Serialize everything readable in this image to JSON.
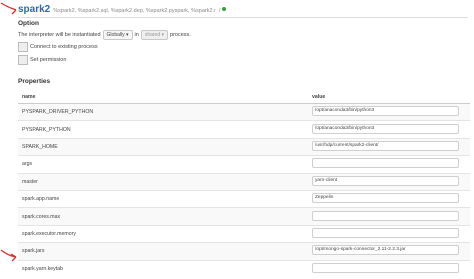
{
  "interpreter": {
    "title": "spark2",
    "bindings": "%spark2, %spark2.sql, %spark2.dep, %spark2.pyspark, %spark2.r",
    "status_color": "#3c9c40"
  },
  "option": {
    "heading": "Option",
    "instantiation_prefix": "The interpreter will be instantiated",
    "scope_value": "Globally",
    "in_label": "in",
    "mode_value": "shared",
    "instantiation_suffix": "process.",
    "connect_existing": "Connect to existing process",
    "set_permission": "Set permission"
  },
  "properties": {
    "heading": "Properties",
    "columns": {
      "name": "name",
      "value": "value"
    },
    "rows": [
      {
        "name": "PYSPARK_DRIVER_PYTHON",
        "value": "/opt/anaconda3/bin/python3"
      },
      {
        "name": "PYSPARK_PYTHON",
        "value": "/opt/anaconda3/bin/python3"
      },
      {
        "name": "SPARK_HOME",
        "value": "/usr/hdp/current/spark2-client/"
      },
      {
        "name": "args",
        "value": ""
      },
      {
        "name": "master",
        "value": "yarn-client"
      },
      {
        "name": "spark.app.name",
        "value": "Zeppelin"
      },
      {
        "name": "spark.cores.max",
        "value": ""
      },
      {
        "name": "spark.executor.memory",
        "value": ""
      },
      {
        "name": "spark.jars",
        "value": "/opt/mongo-spark-connector_2.11-2.2.3.jar"
      },
      {
        "name": "spark.yarn.keytab",
        "value": ""
      }
    ]
  },
  "annotation_color": "#d9302c"
}
